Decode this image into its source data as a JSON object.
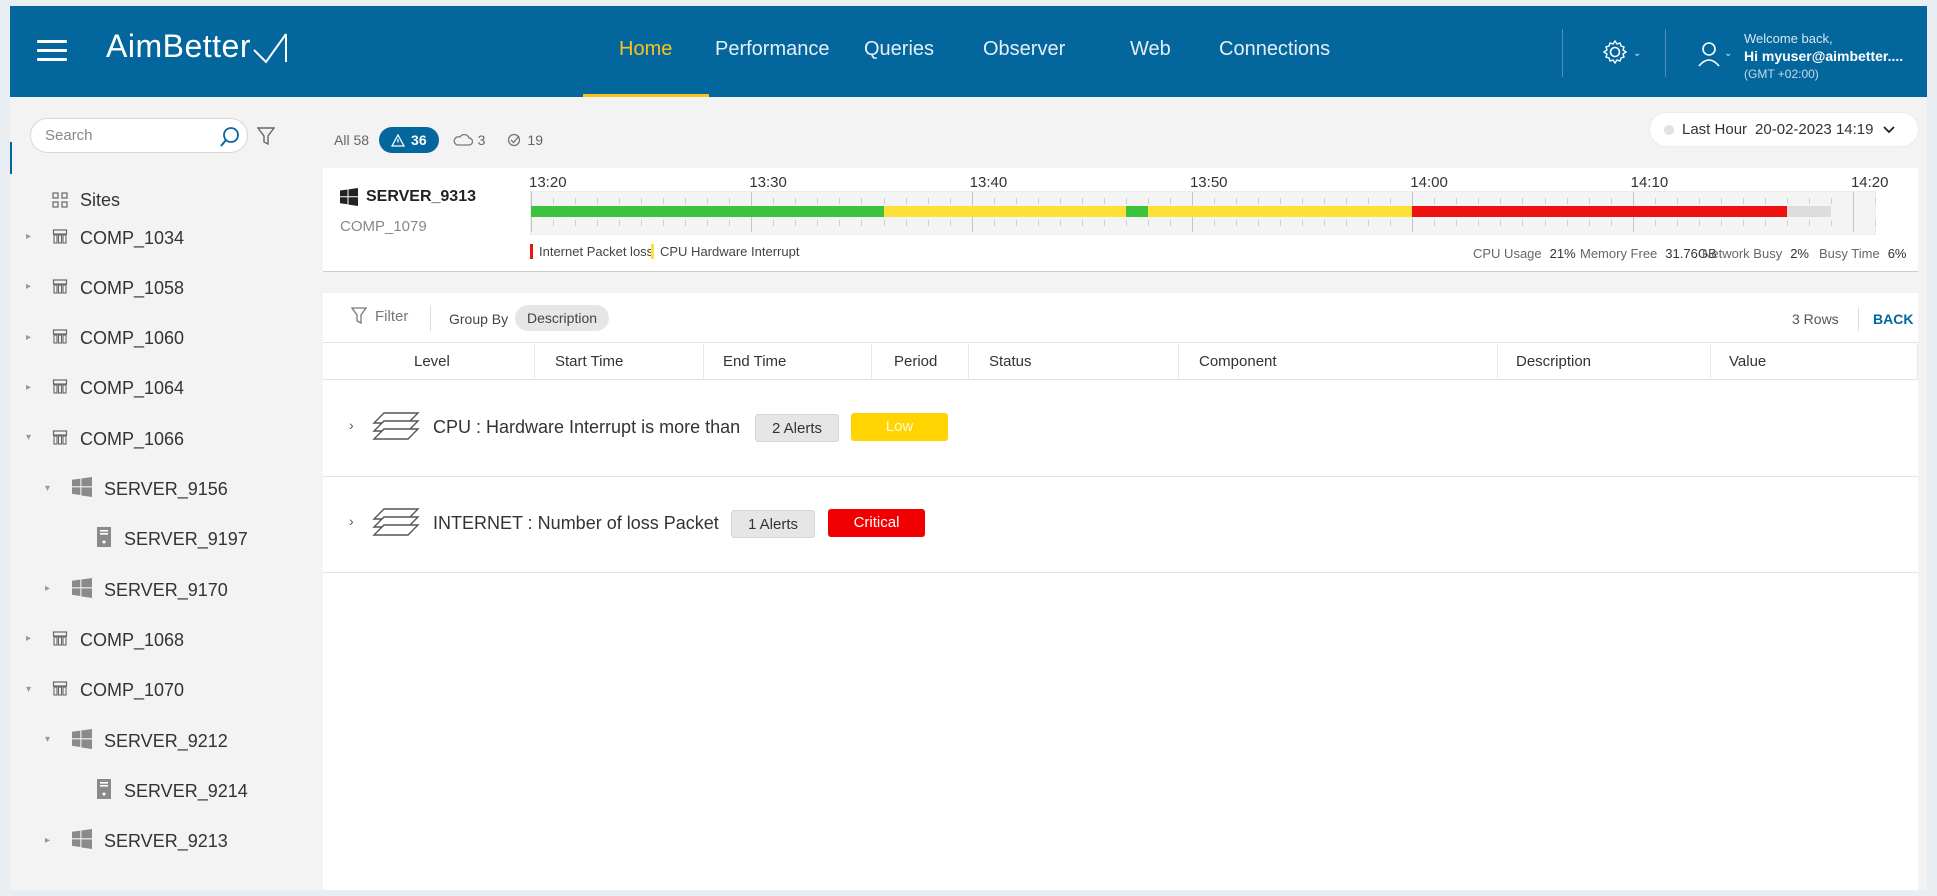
{
  "header": {
    "logo": "AimBetter",
    "nav": [
      "Home",
      "Performance",
      "Queries",
      "Observer",
      "Web",
      "Connections"
    ],
    "active_nav": "Home",
    "welcome": "Welcome back,",
    "user": "Hi myuser@aimbetter....",
    "timezone": "(GMT +02:00)"
  },
  "sidebar": {
    "search_placeholder": "Search",
    "sites_label": "Sites",
    "items": [
      {
        "label": "COMP_1034",
        "type": "comp",
        "expanded": false
      },
      {
        "label": "COMP_1058",
        "type": "comp",
        "expanded": false
      },
      {
        "label": "COMP_1060",
        "type": "comp",
        "expanded": false
      },
      {
        "label": "COMP_1064",
        "type": "comp",
        "expanded": false
      },
      {
        "label": "COMP_1066",
        "type": "comp",
        "expanded": true
      },
      {
        "label": "SERVER_9156",
        "type": "windows",
        "expanded": true
      },
      {
        "label": "SERVER_9197",
        "type": "server",
        "expanded": false
      },
      {
        "label": "SERVER_9170",
        "type": "windows",
        "expanded": false
      },
      {
        "label": "COMP_1068",
        "type": "comp",
        "expanded": false
      },
      {
        "label": "COMP_1070",
        "type": "comp",
        "expanded": true
      },
      {
        "label": "SERVER_9212",
        "type": "windows",
        "expanded": true
      },
      {
        "label": "SERVER_9214",
        "type": "server",
        "expanded": false
      },
      {
        "label": "SERVER_9213",
        "type": "windows",
        "expanded": false
      }
    ]
  },
  "filters": {
    "all_label": "All",
    "all_count": "58",
    "alerts_count": "36",
    "cloud_count": "3",
    "ok_count": "19"
  },
  "time_range": {
    "range": "Last Hour",
    "date": "20-02-2023 14:19"
  },
  "timeline": {
    "server": "SERVER_9313",
    "comp": "COMP_1079",
    "ticks": [
      "13:20",
      "13:30",
      "13:40",
      "13:50",
      "14:00",
      "14:10",
      "14:20"
    ],
    "segments": [
      {
        "from": "13:20",
        "to": "13:36",
        "status": "ok",
        "color": "#3cc23c"
      },
      {
        "from": "13:36",
        "to": "13:47",
        "status": "warning",
        "color": "#fde038"
      },
      {
        "from": "13:47",
        "to": "13:48",
        "status": "ok",
        "color": "#3cc23c"
      },
      {
        "from": "13:48",
        "to": "14:00",
        "status": "warning",
        "color": "#fde038"
      },
      {
        "from": "14:00",
        "to": "14:17",
        "status": "critical",
        "color": "#ee1111"
      },
      {
        "from": "14:17",
        "to": "14:19",
        "status": "no-data",
        "color": "#dddddd"
      }
    ],
    "legend": [
      {
        "label": "Internet Packet loss",
        "color": "#ee1111"
      },
      {
        "label": "CPU Hardware Interrupt",
        "color": "#fde038"
      }
    ],
    "metrics": [
      {
        "label": "CPU Usage",
        "value": "21%"
      },
      {
        "label": "Memory Free",
        "value": "31.76GB"
      },
      {
        "label": "Network Busy",
        "value": "2%"
      },
      {
        "label": "Busy Time",
        "value": "6%"
      }
    ]
  },
  "grid": {
    "filter_label": "Filter",
    "group_by_label": "Group By",
    "group_by_value": "Description",
    "rows_count": "3 Rows",
    "back_label": "BACK",
    "columns": [
      "Level",
      "Start Time",
      "End Time",
      "Period",
      "Status",
      "Component",
      "Description",
      "Value"
    ],
    "groups": [
      {
        "text": "CPU : Hardware Interrupt is more than",
        "alerts": "2 Alerts",
        "severity": "Low",
        "severity_color": "#ffd400"
      },
      {
        "text": "INTERNET : Number of loss Packet",
        "alerts": "1 Alerts",
        "severity": "Critical",
        "severity_color": "#f00000"
      }
    ]
  }
}
